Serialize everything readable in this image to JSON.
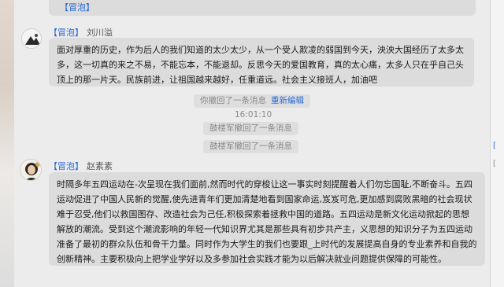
{
  "messages": [
    {
      "tag": "【冒泡】",
      "name": "刘川溢",
      "text": "面对厚重的历史，作为后人的我们知道的太少太少，从一个受人欺凌的弱国到今天，泱泱大国经历了太多太多，这一切真的来之不易，不能忘本，不能退却。反思今天的爱国教育，真的太心痛，太多人只在乎自己头顶上的那一片天。民族前进，让祖国越来越好，任重道远。社会主义接班人，加油吧"
    },
    {
      "tag": "【冒泡】",
      "name": "赵素素",
      "text": "时隔多年五四运动在-次呈现在我们面前,然而时代的穿梭让这一事实时刻提醒着人们勿忘国耻,不断奋斗。五四运动促进了中国人民新的觉醒,使先进青年们更加清楚地看到国家命运,岌岌可危,更加感到腐败黑暗的社会现状难于忍受,他们以救国图存、改造社会为己任,积极探索着拯救中国的道路。五四运动是新文化运动掀起的思想解放的潮流。受到这个潮流影响的年轻一代知识界尤其是那些具有初步共产主，义思想的知识分子为五四运动准备了最初的群众队伍和骨干力量。同时作为大学生的我们也要跟_上时代的发展提高自身的专业素养和自我的创新精神。主要积极向上把学业学好以及多参加社会实践才能为以后解决就业问题提供保障的可能性。"
    }
  ],
  "top_bubble": {
    "tag": "【冒泡】"
  },
  "system": {
    "recall_self": "你撤回了一条消息",
    "reedit": "重新编辑",
    "time": "16:01:10",
    "recall_other_1": "鼓楼军撤回了一条消息",
    "recall_other_2": "鼓楼军撤回了一条消息"
  },
  "right_column": {
    "mark_1": "[",
    "mark_2": "["
  },
  "icons": {
    "scroll_down": "chevron-down-icon"
  }
}
